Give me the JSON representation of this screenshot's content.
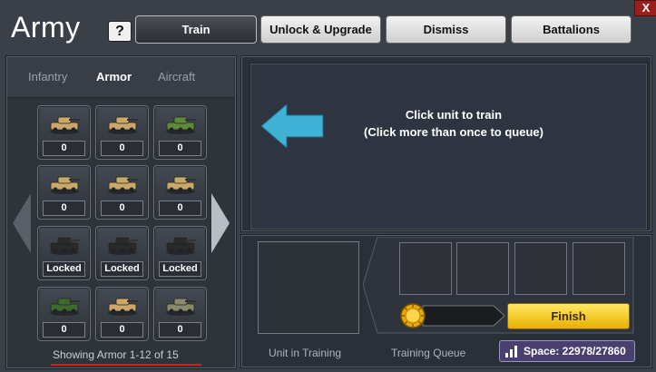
{
  "window": {
    "title": "Army",
    "help_label": "?",
    "close_label": "X"
  },
  "tabs": [
    {
      "label": "Train",
      "active": true
    },
    {
      "label": "Unlock & Upgrade",
      "active": false
    },
    {
      "label": "Dismiss",
      "active": false
    },
    {
      "label": "Battalions",
      "active": false
    }
  ],
  "categories": [
    {
      "label": "Infantry",
      "active": false
    },
    {
      "label": "Armor",
      "active": true
    },
    {
      "label": "Aircraft",
      "active": false
    }
  ],
  "units": [
    {
      "status": "0",
      "icon": "humvee-icon",
      "color": "#c9a86a"
    },
    {
      "status": "0",
      "icon": "armored-car-icon",
      "color": "#c9a86a"
    },
    {
      "status": "0",
      "icon": "green-apc-icon",
      "color": "#5e8a3a"
    },
    {
      "status": "0",
      "icon": "tank-icon",
      "color": "#c9a86a"
    },
    {
      "status": "0",
      "icon": "tank-icon",
      "color": "#c9a86a"
    },
    {
      "status": "0",
      "icon": "tank-icon",
      "color": "#c9a86a"
    },
    {
      "status": "Locked",
      "icon": "locked-vehicle-icon",
      "color": "#2a2a2a"
    },
    {
      "status": "Locked",
      "icon": "locked-vehicle-icon",
      "color": "#2a2a2a"
    },
    {
      "status": "Locked",
      "icon": "locked-vehicle-icon",
      "color": "#2a2a2a"
    },
    {
      "status": "0",
      "icon": "camo-vehicle-icon",
      "color": "#3f6a2e"
    },
    {
      "status": "0",
      "icon": "rocket-truck-icon",
      "color": "#c9a86a"
    },
    {
      "status": "0",
      "icon": "camo-tank-icon",
      "color": "#8a8a6a"
    }
  ],
  "showing_text": "Showing Armor 1-12 of 15",
  "instructions": {
    "line1": "Click unit to train",
    "line2": "(Click more than once to queue)"
  },
  "unit_in_training_label": "Unit in Training",
  "training_queue_label": "Training Queue",
  "finish_label": "Finish",
  "space_text": "Space: 22978/27860",
  "colors": {
    "arrow": "#3fb2d6",
    "finish": "#f5cf2a",
    "underline": "#e01818"
  }
}
